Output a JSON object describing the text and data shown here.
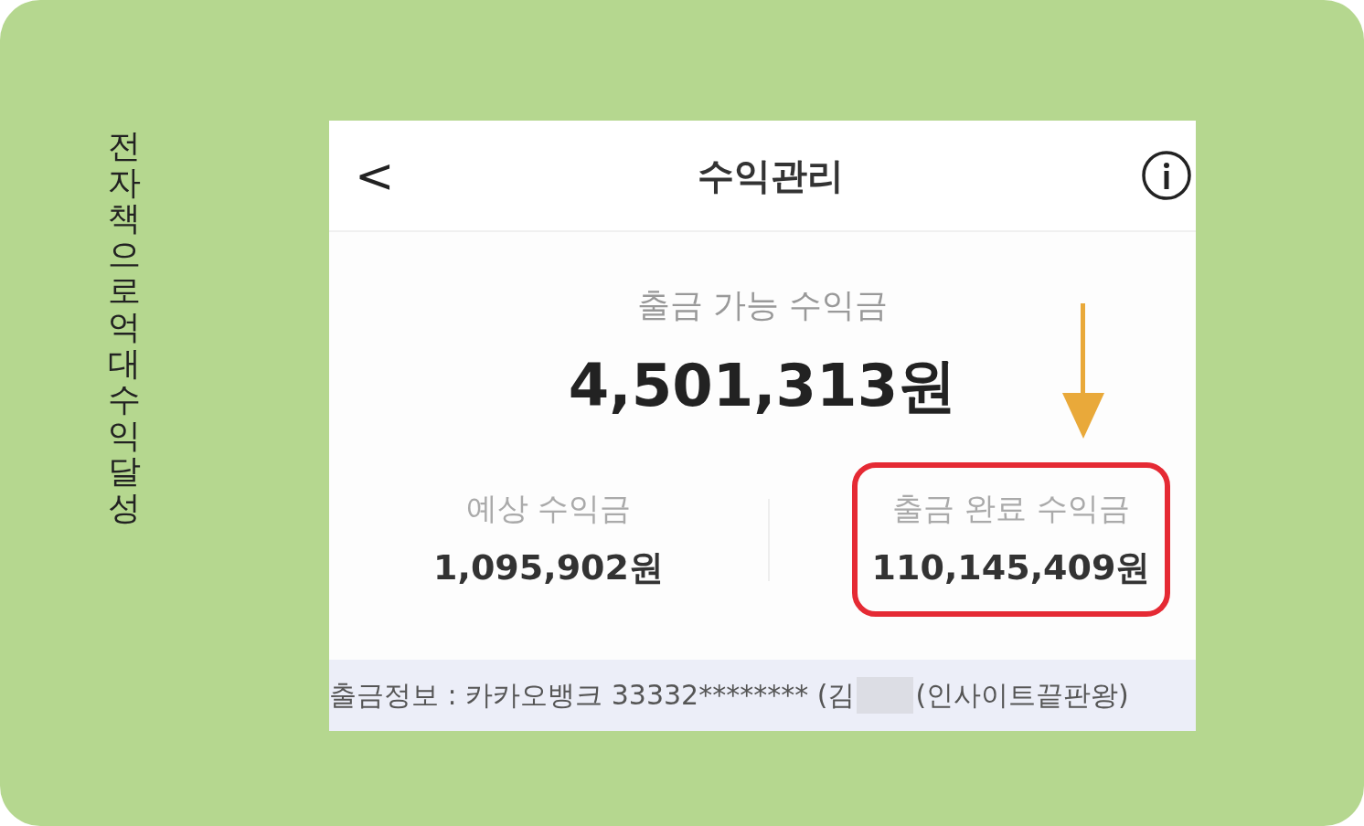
{
  "side_caption": "전자책으로 억대수익 달성",
  "header": {
    "back": "<",
    "title": "수익관리"
  },
  "available": {
    "label": "출금 가능 수익금",
    "amount": "4,501,313원"
  },
  "stats": [
    {
      "label": "예상 수익금",
      "amount": "1,095,902원",
      "highlighted": false
    },
    {
      "label": "출금 완료 수익금",
      "amount": "110,145,409원",
      "highlighted": true
    }
  ],
  "withdraw_info": {
    "text": "출금정보 : 카카오뱅크 33332******** (김",
    "suffix": "(인사이트끝판왕)"
  }
}
